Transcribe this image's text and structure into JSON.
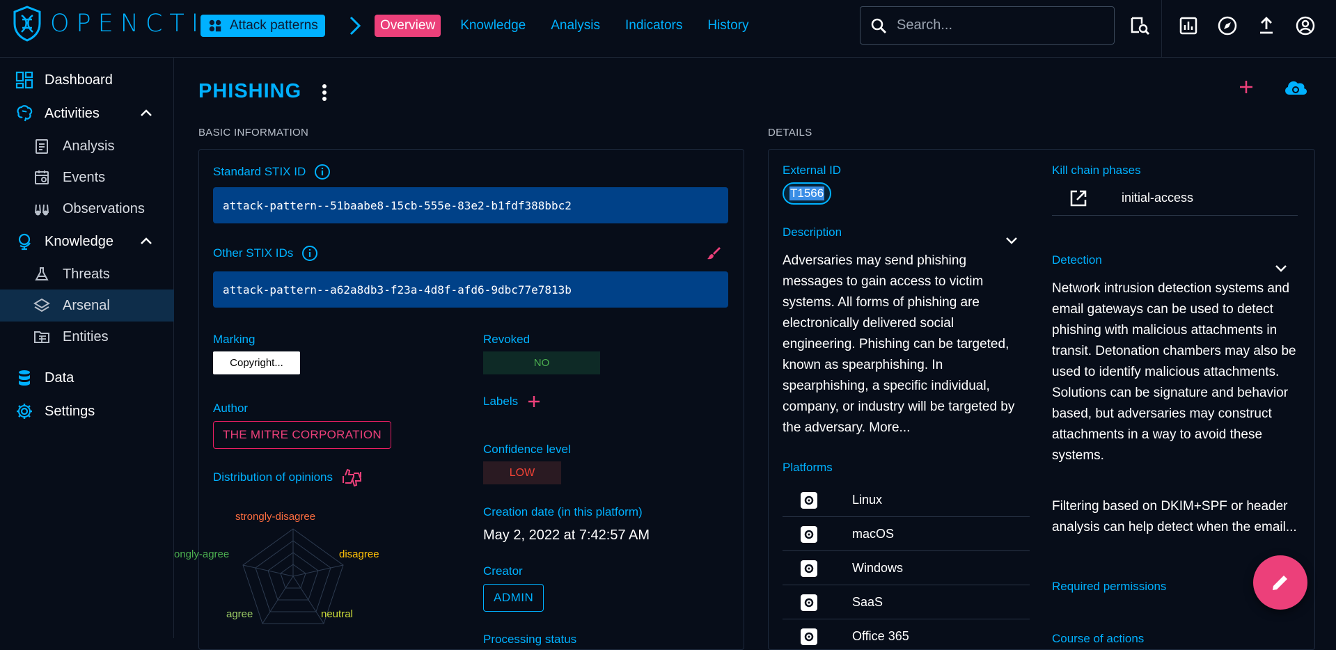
{
  "app": {
    "logo_text": "OPENCTI"
  },
  "header": {
    "entity_chip": "Attack patterns",
    "nav": [
      "Overview",
      "Knowledge",
      "Analysis",
      "Indicators",
      "History"
    ],
    "active_nav": "Overview",
    "search_placeholder": "Search..."
  },
  "sidebar": {
    "items": [
      {
        "label": "Dashboard",
        "icon": "dashboard-icon"
      },
      {
        "label": "Activities",
        "icon": "brain-icon"
      },
      {
        "label": "Analysis",
        "icon": "clipboard-icon"
      },
      {
        "label": "Events",
        "icon": "calendar-icon"
      },
      {
        "label": "Observations",
        "icon": "binoculars-icon"
      },
      {
        "label": "Knowledge",
        "icon": "globe-icon"
      },
      {
        "label": "Threats",
        "icon": "flask-icon"
      },
      {
        "label": "Arsenal",
        "icon": "layers-icon"
      },
      {
        "label": "Entities",
        "icon": "folder-table-icon"
      },
      {
        "label": "Data",
        "icon": "database-icon"
      },
      {
        "label": "Settings",
        "icon": "cog-icon"
      }
    ],
    "selected": "Arsenal"
  },
  "page": {
    "title": "PHISHING",
    "basic_info_heading": "BASIC INFORMATION",
    "details_heading": "DETAILS"
  },
  "basic": {
    "standard_stix_label": "Standard STIX ID",
    "standard_stix_value": "attack-pattern--51baabe8-15cb-555e-83e2-b1fdf388bbc2",
    "other_stix_label": "Other STIX IDs",
    "other_stix_value": "attack-pattern--a62a8db3-f23a-4d8f-afd6-9dbc77e7813b",
    "marking_label": "Marking",
    "marking_value": "Copyright...",
    "revoked_label": "Revoked",
    "revoked_value": "NO",
    "author_label": "Author",
    "author_value": "THE MITRE CORPORATION",
    "labels_label": "Labels",
    "opinions_label": "Distribution of opinions",
    "radar_labels": {
      "strongly_disagree": "strongly-disagree",
      "disagree": "disagree",
      "neutral": "neutral",
      "agree": "agree",
      "strongly_agree": "ongly-agree"
    },
    "confidence_label": "Confidence level",
    "confidence_value": "LOW",
    "creation_label": "Creation date (in this platform)",
    "creation_value": "May 2, 2022 at 7:42:57 AM",
    "creator_label": "Creator",
    "creator_value": "ADMIN",
    "processing_label": "Processing status"
  },
  "details": {
    "external_id_label": "External ID",
    "external_id_value": "T1566",
    "description_label": "Description",
    "description_text": "Adversaries may send phishing messages to gain access to victim systems. All forms of phishing are electronically delivered social engineering. Phishing can be targeted, known as spearphishing. In spearphishing, a specific individual, company, or industry will be targeted by the adversary. More...",
    "platforms_label": "Platforms",
    "platforms": [
      "Linux",
      "macOS",
      "Windows",
      "SaaS",
      "Office 365"
    ],
    "kill_chain_label": "Kill chain phases",
    "kill_chain": [
      "initial-access"
    ],
    "detection_label": "Detection",
    "detection_p1": "Network intrusion detection systems and email gateways can be used to detect phishing with malicious attachments in transit. Detonation chambers may also be used to identify malicious attachments. Solutions can be signature and behavior based, but adversaries may construct attachments in a way to avoid these systems.",
    "detection_p2": "Filtering based on DKIM+SPF or header analysis can help detect when the email...",
    "required_permissions_label": "Required permissions",
    "cut_off_label": "Course of actions"
  },
  "colors": {
    "background": "#070d19",
    "accent": "#00b1ff",
    "secondary": "#ec407a",
    "stix_box": "#004188"
  }
}
